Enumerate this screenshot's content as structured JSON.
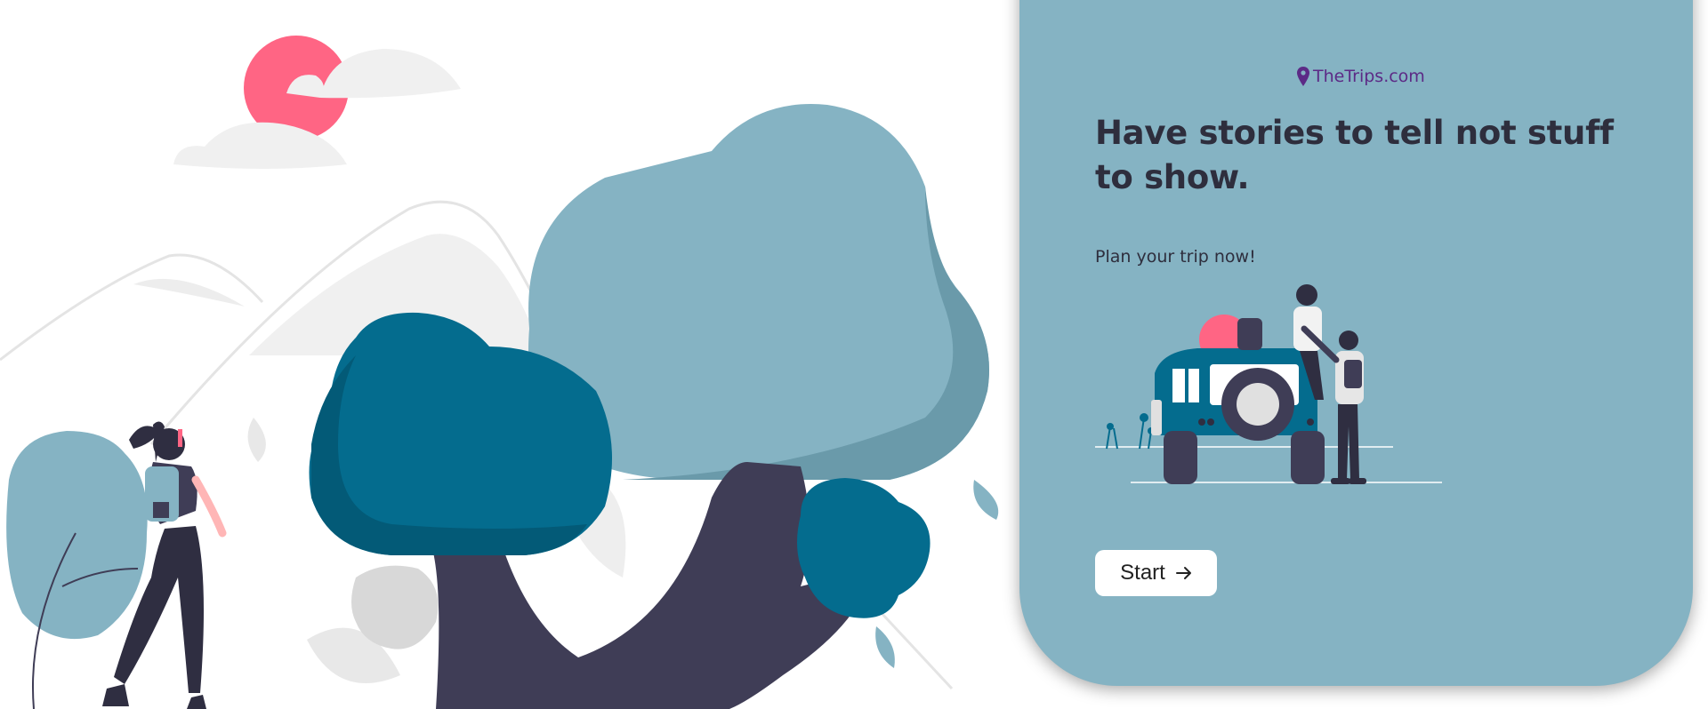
{
  "brand": {
    "name": "TheTrips.com",
    "icon": "map-pin-icon",
    "color": "#5c2a86"
  },
  "hero": {
    "headline": "Have stories to tell not stuff to show.",
    "subheadline": "Plan your trip now!",
    "cta_label": "Start",
    "cta_icon": "arrow-right-icon"
  },
  "colors": {
    "card_bg": "#85b3c3",
    "dark_teal": "#046c8e",
    "light_teal": "#85b3c3",
    "trunk": "#3f3d56",
    "sun": "#ff6584",
    "cloud": "#f0f0f0"
  }
}
